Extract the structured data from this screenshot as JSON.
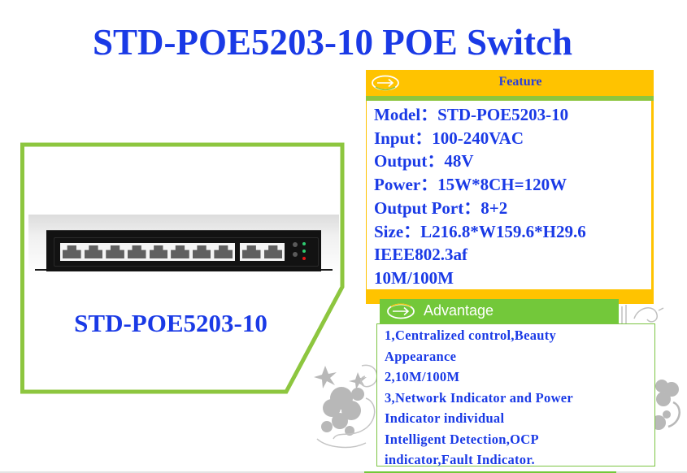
{
  "page": {
    "title": "STD-POE5203-10 POE Switch"
  },
  "product_card": {
    "model_label": "STD-POE5203-10",
    "image_alt": "8+2 port PoE switch front panel",
    "ports": {
      "poe_ports": 8,
      "uplink_ports": 2
    },
    "leds": [
      {
        "state": "off",
        "color": "#5a5a5a"
      },
      {
        "state": "on",
        "color": "#2ecc71"
      },
      {
        "state": "off",
        "color": "#5a5a5a"
      },
      {
        "state": "on",
        "color": "#2ecc71"
      },
      {
        "state": "on",
        "color": "#e01818"
      }
    ],
    "frame_color": "#8dc63f"
  },
  "feature": {
    "icon": "arrow-circle-icon",
    "title": "Feature",
    "header_color": "#ffc300",
    "accent_color": "#8dc63f",
    "specs": [
      "Model：STD-POE5203-10",
      "Input：100-240VAC",
      "Output：48V",
      "Power：15W*8CH=120W",
      "Output Port：8+2",
      "Size：L216.8*W159.6*H29.6",
      "IEEE802.3af",
      "10M/100M"
    ]
  },
  "advantage": {
    "icon": "arrow-circle-icon",
    "title": "Advantage",
    "header_color": "#73c83a",
    "lines": [
      "1,Centralized control,Beauty",
      "Appearance",
      "2,10M/100M",
      "3,Network Indicator and Power",
      "Indicator individual",
      "Intelligent Detection,OCP",
      "indicator,Fault Indicator."
    ]
  },
  "theme": {
    "text_blue": "#1a3ae6"
  }
}
